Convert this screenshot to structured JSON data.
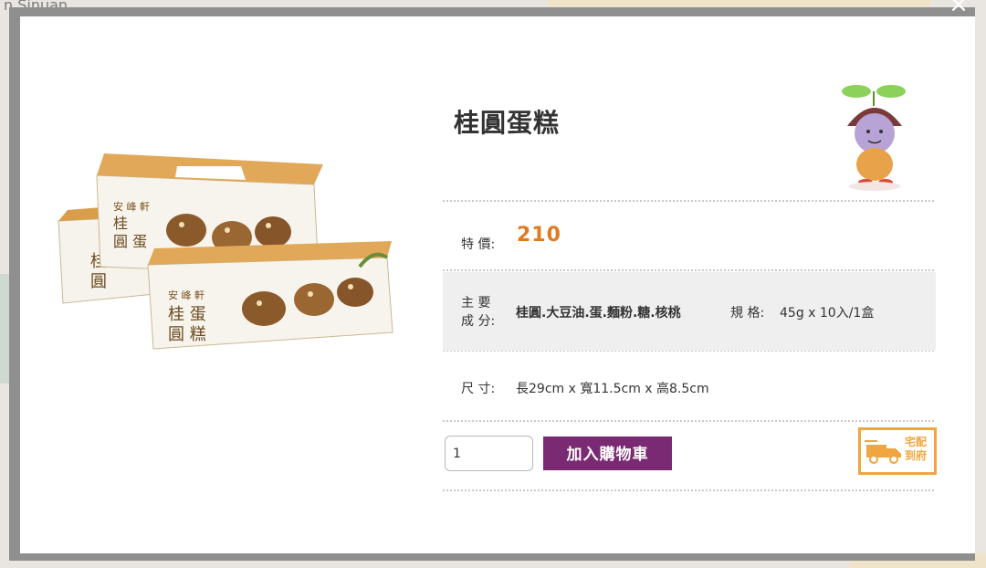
{
  "background": {
    "corner_text": "n Sinuan"
  },
  "modal": {
    "close_label": "×",
    "product": {
      "title": "桂圓蛋糕",
      "price_label": "特 價:",
      "price": "210",
      "ingredients_label_line1": "主 要",
      "ingredients_label_line2": "成 分:",
      "ingredients": "桂圓.大豆油.蛋.麵粉.糖.核桃",
      "spec_label": "規 格:",
      "spec": "45g x 10入/1盒",
      "size_label": "尺 寸:",
      "size": "長29cm x 寬11.5cm x 高8.5cm"
    },
    "quantity": {
      "value": "1"
    },
    "add_to_cart_label": "加入購物車",
    "delivery_badge": {
      "line1": "宅配",
      "line2": "到府"
    }
  },
  "colors": {
    "accent_price": "#e07a22",
    "cart_button": "#7a2a73",
    "delivery_badge": "#f0a640"
  }
}
